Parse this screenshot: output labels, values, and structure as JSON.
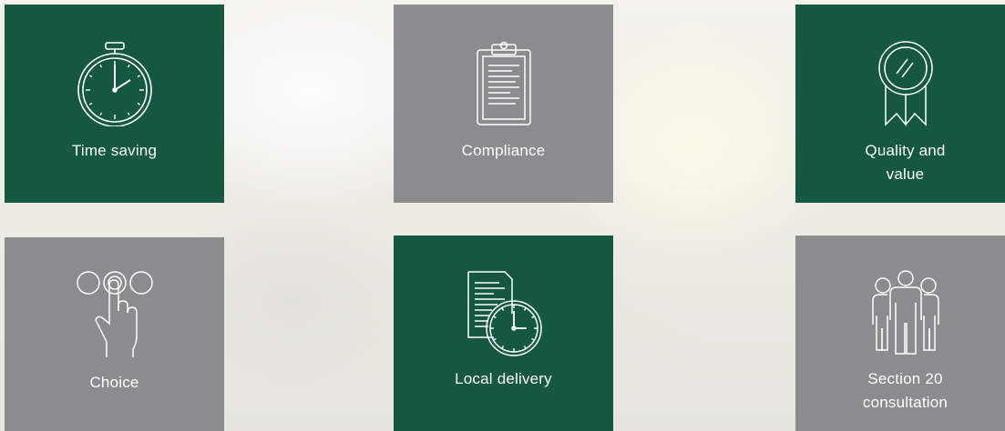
{
  "features": [
    {
      "id": "time-saving",
      "lines": [
        "Time saving"
      ],
      "icon": "stopwatch-icon",
      "color": "#145840"
    },
    {
      "id": "compliance",
      "lines": [
        "Compliance"
      ],
      "icon": "clipboard-icon",
      "color": "#8c8b8e"
    },
    {
      "id": "quality-and-value",
      "lines": [
        "Quality and",
        "value"
      ],
      "icon": "award-ribbon-icon",
      "color": "#145840"
    },
    {
      "id": "choice",
      "lines": [
        "Choice"
      ],
      "icon": "hand-pressing-button-icon",
      "color": "#8c8b8e"
    },
    {
      "id": "local-delivery",
      "lines": [
        "Local delivery"
      ],
      "icon": "document-clock-icon",
      "color": "#145840"
    },
    {
      "id": "section-20-consultation",
      "lines": [
        "Section 20",
        "consultation"
      ],
      "icon": "group-of-people-icon",
      "color": "#8c8b8e"
    }
  ],
  "colors": {
    "green": "#145840",
    "grey": "#8c8b8e",
    "text": "#ffffff"
  }
}
